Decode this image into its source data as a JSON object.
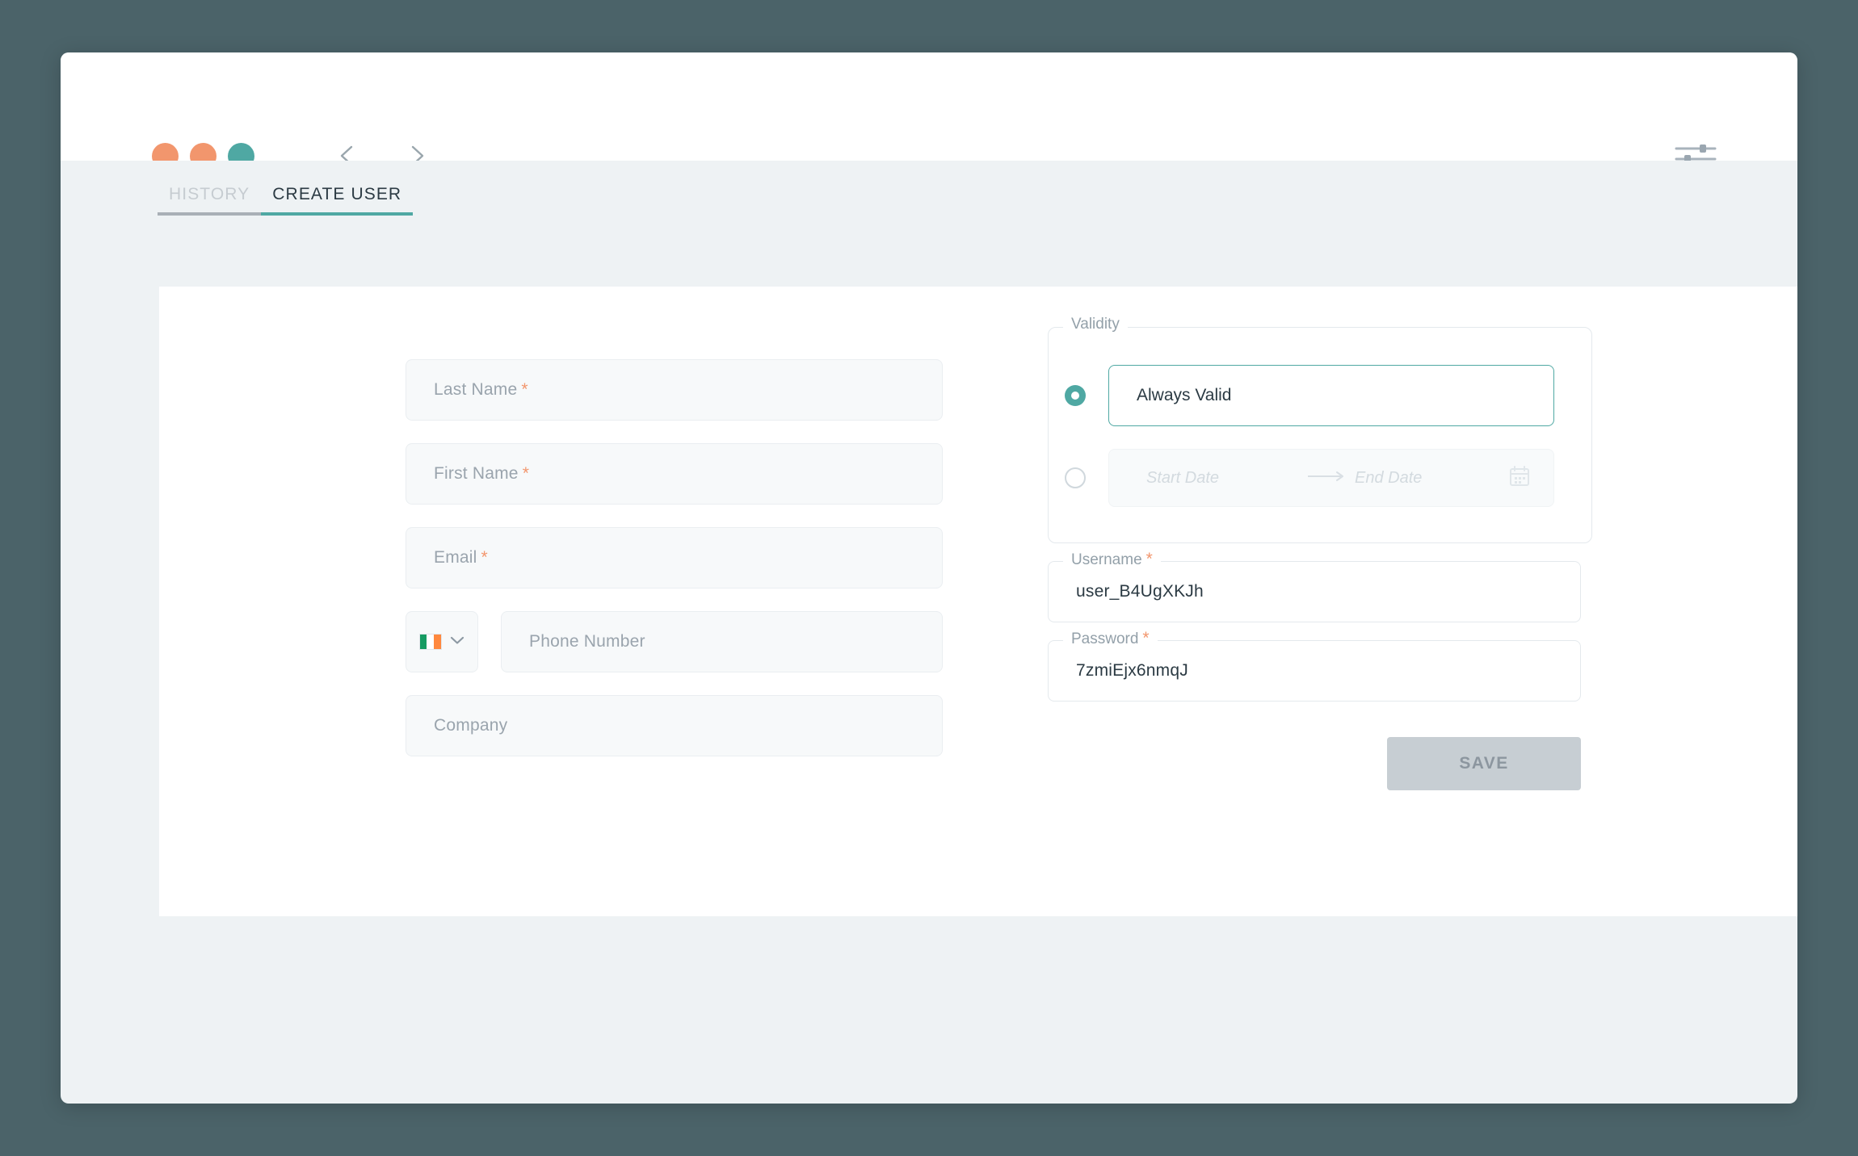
{
  "window": {
    "traffic_lights": [
      {
        "name": "dot-orange-1",
        "color": "#f2966d"
      },
      {
        "name": "dot-orange-2",
        "color": "#f2966d"
      },
      {
        "name": "dot-teal",
        "color": "#4fa8a3"
      }
    ],
    "nav": {
      "back_icon": "chevron-left-icon",
      "forward_icon": "chevron-right-icon"
    },
    "settings_icon": "tune-sliders-icon"
  },
  "tabs": [
    {
      "label": "HISTORY",
      "active": false
    },
    {
      "label": "CREATE USER",
      "active": true
    }
  ],
  "form": {
    "left": {
      "last_name": {
        "placeholder": "Last Name",
        "required": "*",
        "value": ""
      },
      "first_name": {
        "placeholder": "First Name",
        "required": "*",
        "value": ""
      },
      "email": {
        "placeholder": "Email",
        "required": "*",
        "value": ""
      },
      "country_code": {
        "flag": "ireland-flag-icon",
        "chevron": "chevron-down-icon"
      },
      "phone": {
        "placeholder": "Phone Number",
        "value": ""
      },
      "company": {
        "placeholder": "Company",
        "value": ""
      }
    },
    "right": {
      "validity": {
        "legend": "Validity",
        "option_always": {
          "label": "Always Valid",
          "selected": true
        },
        "option_range": {
          "selected": false,
          "start_placeholder": "Start Date",
          "end_placeholder": "End Date",
          "arrow_icon": "arrow-right-icon",
          "calendar_icon": "calendar-icon"
        }
      },
      "username": {
        "label": "Username",
        "required": "*",
        "value": "user_B4UgXKJh"
      },
      "password": {
        "label": "Password",
        "required": "*",
        "value": "7zmiEjx6nmqJ"
      },
      "save_label": "SAVE"
    }
  },
  "colors": {
    "page_background": "#4b6369",
    "window_background": "#eef2f4",
    "card_background": "#ffffff",
    "accent_teal": "#4fa8a3",
    "accent_orange": "#f2966d",
    "required_star": "#f2966d",
    "save_button": "#c7ced3",
    "save_label_color": "#8c969f"
  }
}
